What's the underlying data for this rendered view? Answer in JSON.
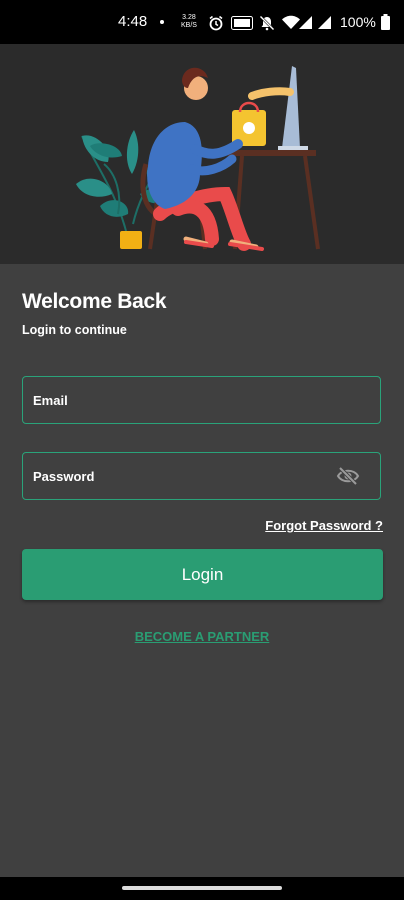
{
  "status_bar": {
    "time": "4:48",
    "net_speed_top": "3.28",
    "net_speed_bottom": "KB/S",
    "battery": "100%"
  },
  "login": {
    "title": "Welcome Back",
    "subtitle": "Login to continue",
    "email_label": "Email",
    "password_label": "Password",
    "forgot_password": "Forgot Password ?",
    "login_button": "Login",
    "become_partner": "BECOME A PARTNER"
  },
  "colors": {
    "accent": "#2a9d73",
    "background": "#404040",
    "hero_background": "#2b2b2b"
  },
  "icons": {
    "alarm": "alarm-icon",
    "mute": "notifications-off-icon",
    "wifi": "wifi-icon",
    "signal": "signal-icon",
    "battery": "battery-icon",
    "password_visibility": "eye-off-icon"
  }
}
